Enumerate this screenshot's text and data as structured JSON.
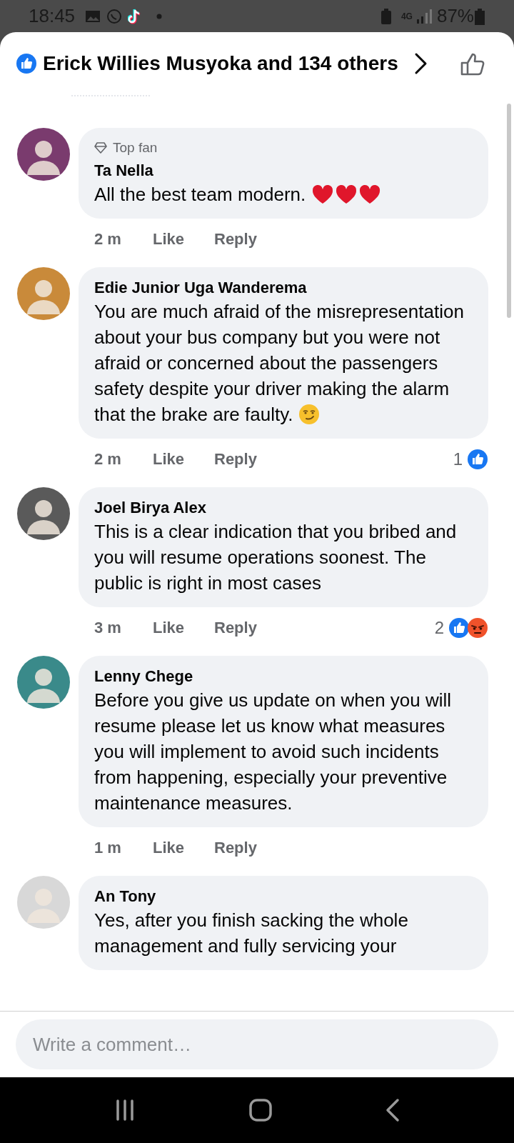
{
  "status_bar": {
    "time": "18:45",
    "battery": "87%",
    "network": "4G"
  },
  "header": {
    "title": "Erick Willies Musyoka and 134 others"
  },
  "comments": [
    {
      "badge": "Top fan",
      "author": "Ta Nella",
      "text": "All the best team modern.",
      "emojis": [
        {
          "kind": "heart"
        },
        {
          "kind": "heart"
        },
        {
          "kind": "heart"
        }
      ],
      "time": "2 m",
      "like": "Like",
      "reply": "Reply"
    },
    {
      "author": "Edie Junior Uga Wanderema",
      "text": "You are much afraid of the misrepresentation about your bus company but you were not afraid or concerned about the passengers safety despite your driver making the alarm that the brake are faulty.",
      "emojis": [
        {
          "kind": "smirk"
        }
      ],
      "time": "2 m",
      "like": "Like",
      "reply": "Reply",
      "reaction_count": "1",
      "reactions": [
        {
          "kind": "like"
        }
      ]
    },
    {
      "author": "Joel Birya Alex",
      "text": "This is a clear indication that you bribed and you will resume operations soonest. The public is right in most cases",
      "time": "3 m",
      "like": "Like",
      "reply": "Reply",
      "reaction_count": "2",
      "reactions": [
        {
          "kind": "like"
        },
        {
          "kind": "angry"
        }
      ]
    },
    {
      "author": "Lenny Chege",
      "text": "Before you give us update on when you will resume please let us know what measures you will implement to avoid such incidents from happening, especially your preventive maintenance measures.",
      "time": "1 m",
      "like": "Like",
      "reply": "Reply"
    },
    {
      "author": "An Tony",
      "text": "Yes, after you finish sacking the whole management and fully servicing your"
    }
  ],
  "composer": {
    "placeholder": "Write a comment…"
  }
}
